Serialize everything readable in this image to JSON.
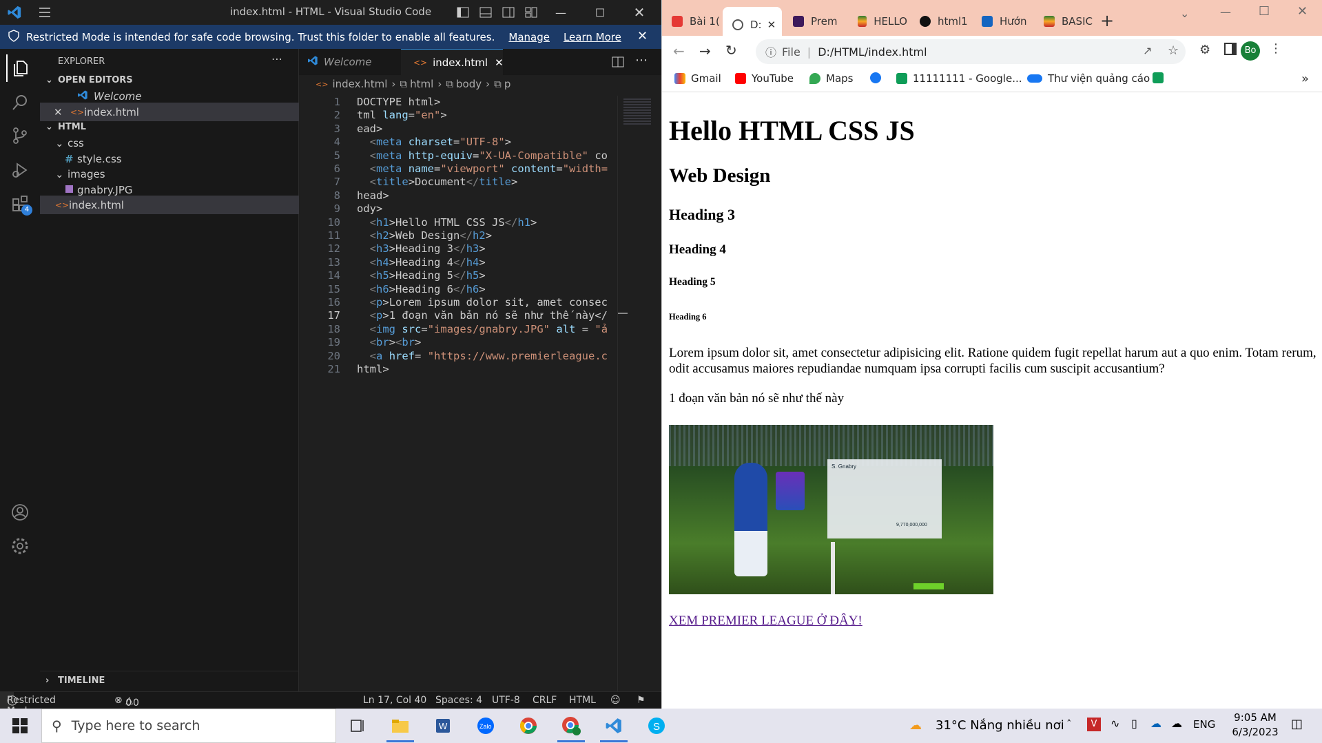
{
  "vscode": {
    "window_title": "index.html - HTML - Visual Studio Code",
    "banner": {
      "text": "Restricted Mode is intended for safe code browsing. Trust this folder to enable all features.",
      "manage": "Manage",
      "learn_more": "Learn More"
    },
    "activity_badge": "4",
    "explorer": {
      "title": "EXPLORER",
      "open_editors_header": "OPEN EDITORS",
      "open_editors": [
        "Welcome",
        "index.html"
      ],
      "folder_header": "HTML",
      "tree": [
        {
          "name": "css",
          "kind": "folder"
        },
        {
          "name": "style.css",
          "kind": "css-file"
        },
        {
          "name": "images",
          "kind": "folder"
        },
        {
          "name": "gnabry.JPG",
          "kind": "image-file"
        },
        {
          "name": "index.html",
          "kind": "html-file"
        }
      ],
      "timeline": "TIMELINE"
    },
    "tabs": [
      "Welcome",
      "index.html"
    ],
    "breadcrumb": [
      "index.html",
      "html",
      "body",
      "p"
    ],
    "code_lines": [
      {
        "n": "1",
        "text": "DOCTYPE html>"
      },
      {
        "n": "2",
        "text": "tml lang=\"en\">"
      },
      {
        "n": "3",
        "text": "ead>"
      },
      {
        "n": "4",
        "text": "  <meta charset=\"UTF-8\">"
      },
      {
        "n": "5",
        "text": "  <meta http-equiv=\"X-UA-Compatible\" co"
      },
      {
        "n": "6",
        "text": "  <meta name=\"viewport\" content=\"width="
      },
      {
        "n": "7",
        "text": "  <title>Document</title>"
      },
      {
        "n": "8",
        "text": "head>"
      },
      {
        "n": "9",
        "text": "ody>"
      },
      {
        "n": "10",
        "text": "  <h1>Hello HTML CSS JS</h1>"
      },
      {
        "n": "11",
        "text": "  <h2>Web Design</h2>"
      },
      {
        "n": "12",
        "text": "  <h3>Heading 3</h3>"
      },
      {
        "n": "13",
        "text": "  <h4>Heading 4</h4>"
      },
      {
        "n": "14",
        "text": "  <h5>Heading 5</h5>"
      },
      {
        "n": "15",
        "text": "  <h6>Heading 6</h6>"
      },
      {
        "n": "16",
        "text": "  <p>Lorem ipsum dolor sit, amet consec"
      },
      {
        "n": "17",
        "text": "  <p>1 đoạn văn bản nó sẽ như thế này</"
      },
      {
        "n": "18",
        "text": "  <img src=\"images/gnabry.JPG\" alt = \"ả"
      },
      {
        "n": "19",
        "text": "  <br><br>"
      },
      {
        "n": "20",
        "text": "  <a href= \"https://www.premierleague.c"
      },
      {
        "n": "21",
        "text": "html>"
      }
    ],
    "status": {
      "mode": "Restricted Mode",
      "errors": "0",
      "warnings": "0",
      "position": "Ln 17, Col 40",
      "spaces": "Spaces: 4",
      "encoding": "UTF-8",
      "eol": "CRLF",
      "language": "HTML"
    }
  },
  "chrome": {
    "tabs": [
      "Bài 1(",
      "D:",
      "Prem",
      "HELLO",
      "html1",
      "Hướn",
      "BASIC"
    ],
    "address": {
      "scheme": "File",
      "path": "D:/HTML/index.html"
    },
    "profile": "Bo",
    "bookmarks": [
      "Gmail",
      "YouTube",
      "Maps",
      "",
      "11111111 - Google...",
      "Thư viện quảng cáo",
      ""
    ],
    "page": {
      "h1": "Hello HTML CSS JS",
      "h2": "Web Design",
      "h3": "Heading 3",
      "h4": "Heading 4",
      "h5": "Heading 5",
      "h6": "Heading 6",
      "p1": "Lorem ipsum dolor sit, amet consectetur adipisicing elit. Ratione quidem fugit repellat harum aut a quo enim. Totam rerum, odit accusamus maiores repudiandae numquam ipsa corrupti facilis cum suscipit accusantium?",
      "p2": "1 đoạn văn bản nó sẽ như thế này",
      "image_player": "S. Gnabry",
      "image_value": "9,770,000,000",
      "link": "XEM PREMIER LEAGUE Ở ĐÂY!"
    }
  },
  "taskbar": {
    "search_placeholder": "Type here to search",
    "weather": "31°C  Nắng nhiều nơi",
    "lang": "ENG",
    "time": "9:05 AM",
    "date": "6/3/2023"
  }
}
